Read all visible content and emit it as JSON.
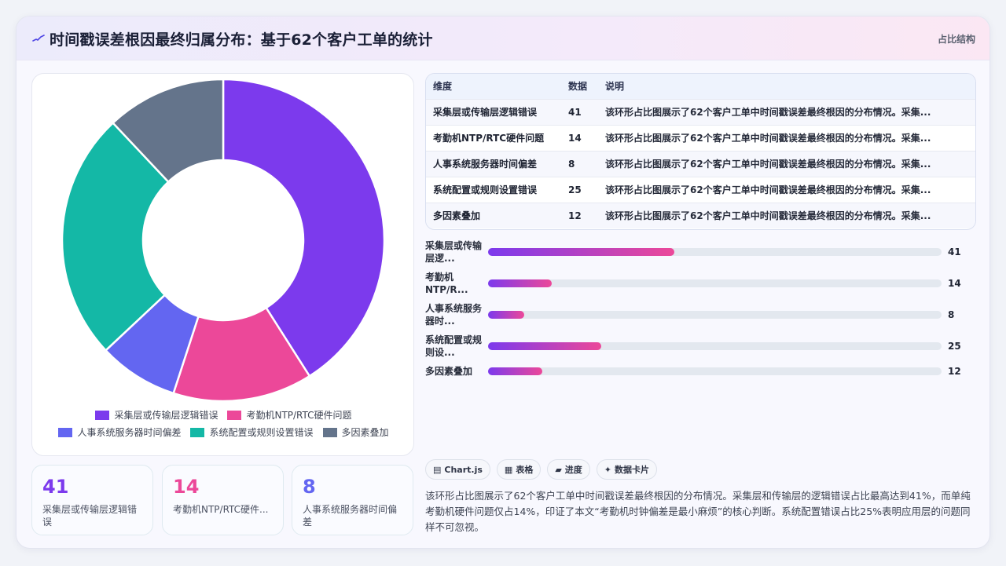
{
  "header": {
    "logo_icon": "pulse-line-icon",
    "title": "时间戳误差根因最终归属分布：基于62个客户工单的统计",
    "badge": "占比结构"
  },
  "chart_data": {
    "type": "doughnut",
    "title": "",
    "categories": [
      "采集层或传输层逻辑错误",
      "考勤机NTP/RTC硬件问题",
      "人事系统服务器时间偏差",
      "系统配置或规则设置错误",
      "多因素叠加"
    ],
    "values": [
      41,
      14,
      8,
      25,
      12
    ],
    "colors": [
      "#7c3aed",
      "#ec4899",
      "#6366f1",
      "#14b8a6",
      "#64748b"
    ],
    "legend_position": "bottom"
  },
  "stats": [
    {
      "value": "41",
      "label": "采集层或传输层逻辑错误",
      "color": "#7c3aed"
    },
    {
      "value": "14",
      "label": "考勤机NTP/RTC硬件...",
      "color": "#ec4899"
    },
    {
      "value": "8",
      "label": "人事系统服务器时间偏差",
      "color": "#6366f1"
    }
  ],
  "table": {
    "headers": [
      "维度",
      "数据",
      "说明"
    ],
    "rows": [
      [
        "采集层或传输层逻辑错误",
        "41",
        "该环形占比图展示了62个客户工单中时间戳误差最终根因的分布情况。采集..."
      ],
      [
        "考勤机NTP/RTC硬件问题",
        "14",
        "该环形占比图展示了62个客户工单中时间戳误差最终根因的分布情况。采集..."
      ],
      [
        "人事系统服务器时间偏差",
        "8",
        "该环形占比图展示了62个客户工单中时间戳误差最终根因的分布情况。采集..."
      ],
      [
        "系统配置或规则设置错误",
        "25",
        "该环形占比图展示了62个客户工单中时间戳误差最终根因的分布情况。采集..."
      ],
      [
        "多因素叠加",
        "12",
        "该环形占比图展示了62个客户工单中时间戳误差最终根因的分布情况。采集..."
      ]
    ]
  },
  "progress": {
    "max": 100,
    "items": [
      {
        "label": "采集层或传输层逻...",
        "value": 41
      },
      {
        "label": "考勤机NTP/R...",
        "value": 14
      },
      {
        "label": "人事系统服务器时...",
        "value": 8
      },
      {
        "label": "系统配置或规则设...",
        "value": 25
      },
      {
        "label": "多因素叠加",
        "value": 12
      }
    ]
  },
  "chips": [
    {
      "icon": "chart-icon",
      "glyph": "▤",
      "label": "Chart.js"
    },
    {
      "icon": "table-icon",
      "glyph": "▦",
      "label": "表格"
    },
    {
      "icon": "progress-icon",
      "glyph": "▰",
      "label": "进度"
    },
    {
      "icon": "sparkle-icon",
      "glyph": "✦",
      "label": "数据卡片"
    }
  ],
  "summary": "该环形占比图展示了62个客户工单中时间戳误差最终根因的分布情况。采集层和传输层的逻辑错误占比最高达到41%，而单纯考勤机硬件问题仅占14%，印证了本文“考勤机时钟偏差是最小麻烦”的核心判断。系统配置错误占比25%表明应用层的问题同样不可忽视。"
}
